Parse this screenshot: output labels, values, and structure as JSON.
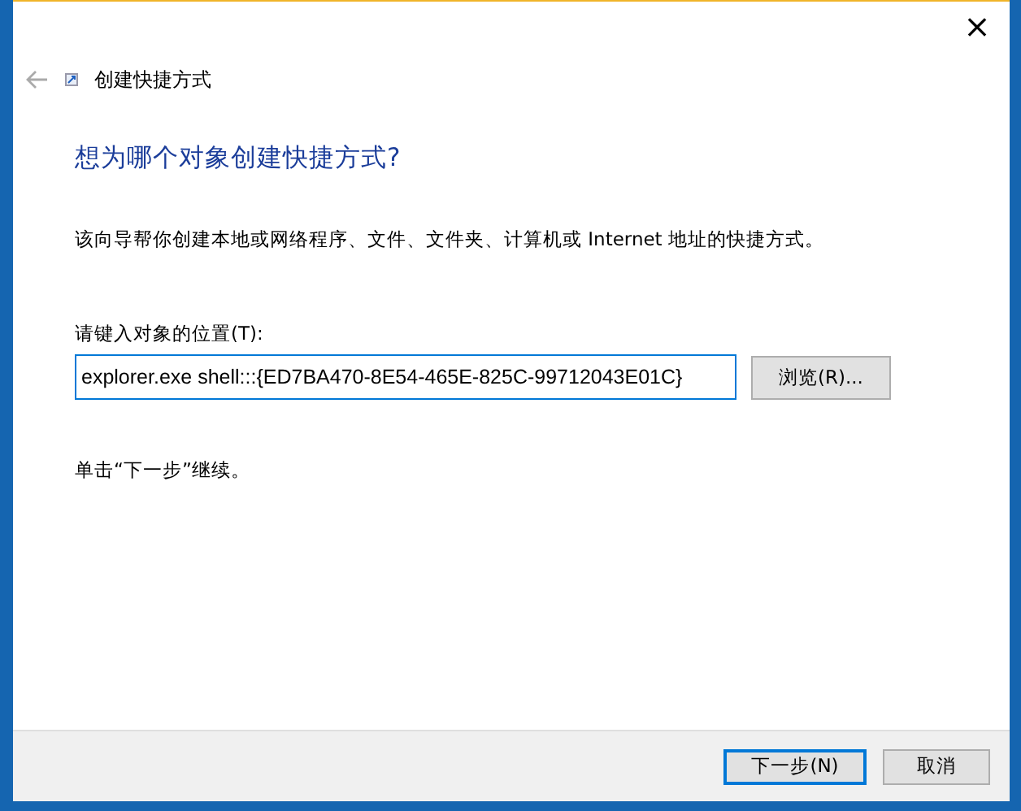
{
  "window": {
    "close": "×",
    "title": "创建快捷方式"
  },
  "heading": "想为哪个对象创建快捷方式?",
  "description": "该向导帮你创建本地或网络程序、文件、文件夹、计算机或 Internet 地址的快捷方式。",
  "location": {
    "label": "请键入对象的位置(T):",
    "value": "explorer.exe shell:::{ED7BA470-8E54-465E-825C-99712043E01C}",
    "browse": "浏览(R)..."
  },
  "hint": "单击“下一步”继续。",
  "buttons": [
    {
      "label": "下一步(N)",
      "default": true
    },
    {
      "label": "取消",
      "default": false
    }
  ]
}
